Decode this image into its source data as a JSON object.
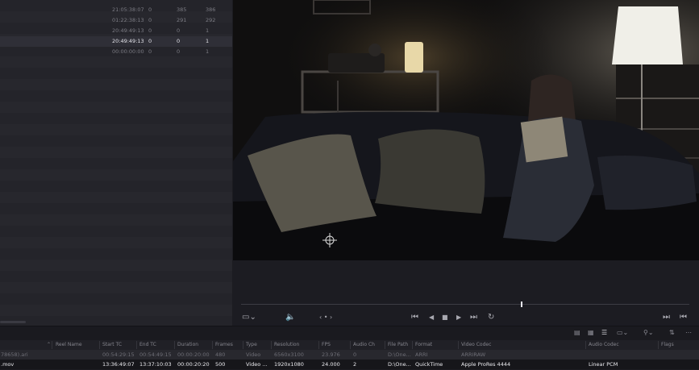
{
  "left_list": {
    "rows": [
      {
        "tc": "21:05:38:07",
        "a": "0",
        "b": "385",
        "c": "386",
        "selected": false
      },
      {
        "tc": "01:22:38:13",
        "a": "0",
        "b": "291",
        "c": "292",
        "selected": false
      },
      {
        "tc": "20:49:49:13",
        "a": "0",
        "b": "0",
        "c": "1",
        "selected": false
      },
      {
        "tc": "20:49:49:13",
        "a": "0",
        "b": "0",
        "c": "1",
        "selected": true
      },
      {
        "tc": "00:00:00:00",
        "a": "0",
        "b": "0",
        "c": "1",
        "selected": false
      }
    ]
  },
  "viewer": {
    "image": "dark living room, woman reading on sofa, lamp-lit",
    "cursor_icon": "crosshair-icon",
    "nav_glyph": "‹ • ›",
    "playhead_fraction": 0.625
  },
  "transport": {
    "skip_back": "⏮",
    "step_back": "◀",
    "stop": "■",
    "play": "▶",
    "skip_fwd": "⏭",
    "loop": "↻",
    "end_left": "⏭",
    "end_right": "⏮"
  },
  "table": {
    "columns": [
      "Reel Name",
      "Start TC",
      "End TC",
      "Duration",
      "Frames",
      "Type",
      "Resolution",
      "FPS",
      "Audio Ch",
      "File Path",
      "Format",
      "Video Codec",
      "Audio Codec",
      "Flags"
    ],
    "rows": [
      {
        "name": "78658).ari",
        "reel": "",
        "start": "00:54:29:15",
        "end": "00:54:49:15",
        "duration": "00:00:20:00",
        "frames": "480",
        "type": "Video",
        "resolution": "6560x3100",
        "fps": "23.976",
        "audio_ch": "0",
        "path": "D:\\One...",
        "format": "ARRI",
        "vcodec": "ARRIRAW",
        "acodec": "",
        "flags": ""
      },
      {
        "name": ".mov",
        "reel": "",
        "start": "13:36:49:07",
        "end": "13:37:10:03",
        "duration": "00:00:20:20",
        "frames": "500",
        "type": "Video ...",
        "resolution": "1920x1080",
        "fps": "24.000",
        "audio_ch": "2",
        "path": "D:\\One...",
        "format": "QuickTime",
        "vcodec": "Apple ProRes 4444",
        "acodec": "Linear PCM",
        "flags": ""
      }
    ]
  },
  "colors": {
    "accent": "#e8e8ee",
    "selected_row_bg": "#16161a"
  }
}
